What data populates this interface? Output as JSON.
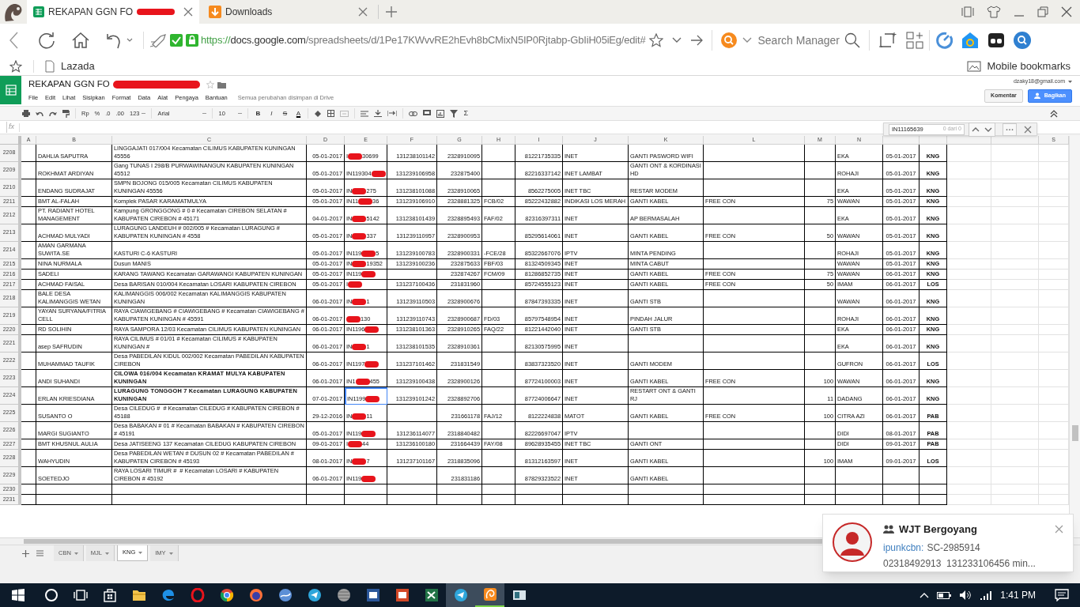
{
  "browser": {
    "tabs": [
      {
        "title": "REKAPAN GGN FO",
        "kind": "spreadsheet",
        "redacted": true,
        "selected": true
      },
      {
        "title": "Downloads",
        "kind": "download",
        "redacted": false,
        "selected": false
      }
    ],
    "url": {
      "scheme": "https://",
      "host": "docs.google.com",
      "path": "/spreadsheets/d/1Pe17KWvvRE2hEvh8bCMixN5IP0Rjtabp-GbIiH05iEg/edit#"
    },
    "search_placeholder": "Search Manager",
    "bookmarks": [
      "Lazada"
    ],
    "mobile_bookmarks": "Mobile bookmarks"
  },
  "sheets": {
    "title": "REKAPAN GGN FO",
    "title_redacted": true,
    "menu": [
      "File",
      "Edit",
      "Lihat",
      "Sisipkan",
      "Format",
      "Data",
      "Alat",
      "Pengaya",
      "Bantuan"
    ],
    "save_status": "Semua perubahan disimpan di Drive",
    "account": "dzaky18@gmail.com",
    "buttons": [
      {
        "label": "Komentar",
        "kind": "plain"
      },
      {
        "label": "Bagikan",
        "kind": "primary"
      }
    ],
    "toolbar": {
      "number_formats": [
        "Rp",
        "%",
        ".0",
        ".00",
        "123"
      ],
      "font": "Arial",
      "font_size": "10",
      "text_styles": [
        {
          "label": "B",
          "kind": "bold"
        },
        {
          "label": "I",
          "kind": "italic"
        },
        {
          "label": "S",
          "kind": "strike"
        },
        {
          "label": "A",
          "kind": "color"
        }
      ],
      "functions": "Σ"
    },
    "formula_label": "fx",
    "find": {
      "query": "IN11165639",
      "count": "0 dari 0"
    },
    "column_headers": [
      "A",
      "B",
      "C",
      "D",
      "E",
      "F",
      "G",
      "H",
      "I",
      "J",
      "K",
      "L",
      "M",
      "N"
    ],
    "last_column_header": "S",
    "rows": [
      {
        "number": "2208",
        "bold": false,
        "B": "DAHLIA SAPUTRA",
        "C": "LINGGAJATI 017/004 Kecamatan CILIMUS KABUPATEN KUNINGAN 45556",
        "D": "05-01-2017",
        "E": {
          "before": "I",
          "after": "30699",
          "selected": false
        },
        "F": "131238101142",
        "G": "2328910095",
        "I": "81221735335",
        "J": "INET",
        "K": "GANTI PASWORD WIFI",
        "N": "EKA",
        "O": "05-01-2017",
        "P": "KNG"
      },
      {
        "number": "2209",
        "bold": false,
        "B": "ROKHMAT ARDIYAN",
        "C": "Gang TUNAS I 298/B PURWAWINANGUN KABUPATEN KUNINGAN 45512",
        "D": "05-01-2017",
        "E": {
          "before": "IN119304",
          "selected": false
        },
        "F": "131239106958",
        "G": "232875400",
        "I": "82216337142",
        "J": "INET LAMBAT",
        "K": "GANTI ONT & KORDINASI HD",
        "N": "ROHAJI",
        "O": "05-01-2017",
        "P": "KNG"
      },
      {
        "number": "2210",
        "bold": false,
        "B": "ENDANG SUDRAJAT",
        "C": "SMPN BOJONG 015/005 Kecamatan CILIMUS KABUPATEN KUNINGAN 45556",
        "D": "05-01-2017",
        "E": {
          "before": "IN",
          "after": "275",
          "selected": false
        },
        "F": "131238101088",
        "G": "2328910065",
        "I": "8562275005",
        "J": "INET TBC",
        "K": "RESTAR MODEM",
        "N": "EKA",
        "O": "05-01-2017",
        "P": "KNG"
      },
      {
        "number": "2211",
        "bold": false,
        "B": "BMT AL-FALAH",
        "C": "Komplek PASAR KARAMATMULYA",
        "D": "05-01-2017",
        "E": {
          "before": "IN11",
          "after": "36",
          "selected": false
        },
        "F": "131239106910",
        "G": "2328881325",
        "H": "FCB/02",
        "I": "85222432882",
        "J": "INDIKASI LOS MERAH",
        "K": "GANTI KABEL",
        "L": "FREE CON",
        "M": "75",
        "N": "WAWAN",
        "O": "05-01-2017",
        "P": "KNG"
      },
      {
        "number": "2212",
        "bold": false,
        "B": "PT. RADIANT HOTEL MANAGEMENT",
        "C": "Kampung GRONGGONG # 0 # Kecamatan CIREBON SELATAN # KABUPATEN CIREBON # 45171",
        "D": "04-01-2017",
        "E": {
          "before": "IN",
          "after": "5142",
          "selected": false
        },
        "F": "131238101439",
        "G": "2328895493",
        "H": "FAF/02",
        "I": "82316397311",
        "J": "INET",
        "K": "AP BERMASALAH",
        "N": "EKA",
        "O": "05-01-2017",
        "P": "KNG"
      },
      {
        "number": "2213",
        "bold": false,
        "B": "ACHMAD MULYADI",
        "C": "LURAGUNG LANDEUH # 002/005 # Kecamatan LURAGUNG # KABUPATEN KUNINGAN # 4558",
        "D": "05-01-2017",
        "E": {
          "before": "IN",
          "after": "337",
          "selected": false
        },
        "F": "131239110957",
        "G": "2328900953",
        "I": "85295614061",
        "J": "INET",
        "K": "GANTI KABEL",
        "L": "FREE CON",
        "M": "50",
        "N": "WAWAN",
        "O": "05-01-2017",
        "P": "KNG"
      },
      {
        "number": "2214",
        "bold": false,
        "B": "AMAN GARMANA SUWITA.SE",
        "C": "KASTURI C-6 KASTURI",
        "D": "05-01-2017",
        "E": {
          "before": "IN119",
          "after": "5",
          "selected": false
        },
        "F": "131239100783",
        "G": "2328900331",
        "H": "-FCE/28",
        "I": "85322667076",
        "J": "IPTV",
        "K": "MINTA PENDING",
        "N": "ROHAJI",
        "O": "05-01-2017",
        "P": "KNG"
      },
      {
        "number": "2215",
        "bold": false,
        "B": "NINA NURMALA",
        "C": "Dusun MANIS",
        "D": "05-01-2017",
        "E": {
          "before": "IN",
          "after": "19352",
          "selected": false
        },
        "F": "131239100236",
        "G": "232875633",
        "H": "FBF/03",
        "I": "81324509345",
        "J": "INET",
        "K": "MINTA CABUT",
        "N": "WAWAN",
        "O": "05-01-2017",
        "P": "KNG"
      },
      {
        "number": "2216",
        "bold": false,
        "B": "SADELI",
        "C": "KARANG TAWANG Kecamatan GARAWANGI KABUPATEN KUNINGAN",
        "D": "05-01-2017",
        "E": {
          "before": "IN119",
          "selected": false
        },
        "G": "232874267",
        "H": "FCM/09",
        "I": "81286852735",
        "J": "INET",
        "K": "GANTI KABEL",
        "L": "FREE CON",
        "M": "75",
        "N": "WAWAN",
        "O": "06-01-2017",
        "P": "KNG"
      },
      {
        "number": "2217",
        "bold": false,
        "B": "ACHMAD FAISAL",
        "C": "Desa BARISAN 010/004 Kecamatan LOSARI KABUPATEN CIREBON",
        "D": "05-01-2017",
        "E": {
          "before": "I",
          "selected": false
        },
        "F": "131237100436",
        "G": "231831960",
        "I": "85724555123",
        "J": "INET",
        "K": "GANTI KABEL",
        "L": "FREE CON",
        "M": "50",
        "N": "IMAM",
        "O": "06-01-2017",
        "P": "LOS"
      },
      {
        "number": "2218",
        "bold": false,
        "B": "BALE DESA KALIMANGGIS WETAN",
        "C": "KALIMANGGIS 006/002 Kecamatan KALIMANGGIS KABUPATEN KUNINGAN",
        "D": "06-01-2017",
        "E": {
          "before": "IN",
          "after": "1",
          "selected": false
        },
        "F": "131239110503",
        "G": "2328900676",
        "I": "87847393335",
        "J": "INET",
        "K": "GANTI STB",
        "N": "WAWAN",
        "O": "06-01-2017",
        "P": "KNG"
      },
      {
        "number": "2219",
        "bold": false,
        "B": "YAYAN SURYANA/FITRIA CELL",
        "C": "RAYA CIAWIGEBANG # CIAWIGEBANG # Kecamatan CIAWIGEBANG # KABUPATEN KUNINGAN # 45591",
        "D": "06-01-2017",
        "E": {
          "after": "130",
          "selected": false
        },
        "F": "131239110743",
        "G": "2328900687",
        "H": "FD/03",
        "I": "85797548954",
        "J": "INET",
        "K": "PINDAH JALUR",
        "N": "ROHAJI",
        "O": "06-01-2017",
        "P": "KNG"
      },
      {
        "number": "2220",
        "bold": false,
        "B": "RD SOLIHIN",
        "C": "RAYA SAMPORA 12/03 Kecamatan CILIMUS KABUPATEN KUNINGAN",
        "D": "06-01-2017",
        "E": {
          "before": "IN1196",
          "selected": false
        },
        "F": "131238101363",
        "G": "2328910265",
        "H": "FAQ/22",
        "I": "81221442040",
        "J": "INET",
        "K": "GANTI STB",
        "N": "EKA",
        "O": "06-01-2017",
        "P": "KNG"
      },
      {
        "number": "2221",
        "bold": false,
        "B": "asep SAFRUDIN",
        "C": "RAYA CILIMUS # 01/01 # Kecamatan CILIMUS # KABUPATEN KUNINGAN #",
        "D": "06-01-2017",
        "E": {
          "before": "IN",
          "after": "1",
          "selected": false
        },
        "F": "131238101535",
        "G": "2328910361",
        "I": "82130575995",
        "J": "INET",
        "N": "EKA",
        "O": "06-01-2017",
        "P": "KNG"
      },
      {
        "number": "2222",
        "bold": false,
        "B": "MUHAMMAD TAUFIK",
        "C": "Desa PABEDILAN KIDUL 002/002 Kecamatan PABEDILAN KABUPATEN CIREBON",
        "D": "06-01-2017",
        "E": {
          "before": "IN1197",
          "selected": false
        },
        "F": "131237101462",
        "G": "231831549",
        "I": "83837323520",
        "J": "INET",
        "K": "GANTI MODEM",
        "N": "GUFRON",
        "O": "06-01-2017",
        "P": "LOS"
      },
      {
        "number": "2223",
        "bold": true,
        "B": "ANDI SUHANDI",
        "C": "CILOWA 016/004 Kecamatan KRAMAT MULYA KABUPATEN KUNINGAN",
        "D": "06-01-2017",
        "E": {
          "before": "IN1",
          "after": "455",
          "selected": false
        },
        "F": "131239100438",
        "G": "2328900126",
        "I": "87724100003",
        "J": "INET",
        "K": "GANTI KABEL",
        "L": "FREE CON",
        "M": "100",
        "N": "WAWAN",
        "O": "06-01-2017",
        "P": "KNG"
      },
      {
        "number": "2224",
        "bold": true,
        "B": "ERLAN KRIESDIANA",
        "C": "LURAGUNG TONGGOH 7 Kecamatan LURAGUNG KABUPATEN KUNINGAN",
        "D": "07-01-2017",
        "E": {
          "before": "IN1199",
          "selected": true
        },
        "F": "131239101242",
        "G": "2328892706",
        "I": "87724006647",
        "J": "INET",
        "K": "RESTART ONT & GANTI RJ",
        "M": "11",
        "N": "DADANG",
        "O": "06-01-2017",
        "P": "KNG"
      },
      {
        "number": "2225",
        "bold": false,
        "B": "SUSANTO O",
        "C": "Desa CILEDUG #  # Kecamatan CILEDUG # KABUPATEN CIREBON # 45188",
        "D": "29-12-2016",
        "E": {
          "before": "IN",
          "after": "11",
          "selected": false
        },
        "G": "231661178",
        "H": "FAJ/12",
        "I": "8122224838",
        "J": "MATOT",
        "K": "GANTI KABEL",
        "L": "FREE CON",
        "M": "100",
        "N": "CITRA AZI",
        "O": "06-01-2017",
        "P": "PAB"
      },
      {
        "number": "2226",
        "bold": false,
        "B": "MARGI SUGIANTO",
        "C": "Desa BABAKAN # 01 # Kecamatan BABAKAN # KABUPATEN CIREBON # 45191",
        "D": "05-01-2017",
        "E": {
          "before": "IN119",
          "selected": false
        },
        "F": "131236114077",
        "G": "2318840482",
        "I": "82226697047",
        "J": "IPTV",
        "N": "DIDI",
        "O": "08-01-2017",
        "P": "PAB"
      },
      {
        "number": "2227",
        "bold": false,
        "B": "BMT KHUSNUL AULIA",
        "C": "Desa JATISEENG 137 Kecamatan CILEDUG KABUPATEN CIREBON",
        "D": "09-01-2017",
        "E": {
          "before": "I",
          "after": "44",
          "selected": false
        },
        "F": "131236100180",
        "G": "231664439",
        "H": "FAY/08",
        "I": "89628935455",
        "J": "INET TBC",
        "K": "GANTI ONT",
        "N": "DIDI",
        "O": "09-01-2017",
        "P": "PAB"
      },
      {
        "number": "2228",
        "bold": false,
        "B": "WAHYUDIN",
        "C": "Desa PABEDILAN WETAN # DUSUN 02 # Kecamatan PABEDILAN # KABUPATEN CIREBON # 45193",
        "D": "08-01-2017",
        "E": {
          "before": "IN",
          "after": "7",
          "selected": false
        },
        "F": "131237101167",
        "G": "2318835096",
        "I": "81312163597",
        "J": "INET",
        "K": "GANTI KABEL",
        "M": "100",
        "N": "IMAM",
        "O": "09-01-2017",
        "P": "LOS"
      },
      {
        "number": "2229",
        "bold": false,
        "B": "SOETEDJO",
        "C": "RAYA LOSARI TIMUR #  # Kecamatan LOSARI # KABUPATEN CIREBON # 45192",
        "D": "06-01-2017",
        "E": {
          "before": "IN119",
          "selected": false
        },
        "G": "231831186",
        "I": "87829323522",
        "J": "INET",
        "K": "GANTI KABEL"
      },
      {
        "number": "2230"
      },
      {
        "number": "2231"
      }
    ],
    "sheet_tabs": [
      {
        "label": "CBN",
        "selected": false
      },
      {
        "label": "MJL",
        "selected": false
      },
      {
        "label": "KNG",
        "selected": true
      },
      {
        "label": "IMY",
        "selected": false
      }
    ]
  },
  "notification": {
    "title": "WJT Bergoyang",
    "sender": "ipunkcbn:",
    "message": "SC-2985914",
    "preview": "02318492913  131233106456 min..."
  },
  "taskbar": {
    "time": "1:41 PM"
  }
}
